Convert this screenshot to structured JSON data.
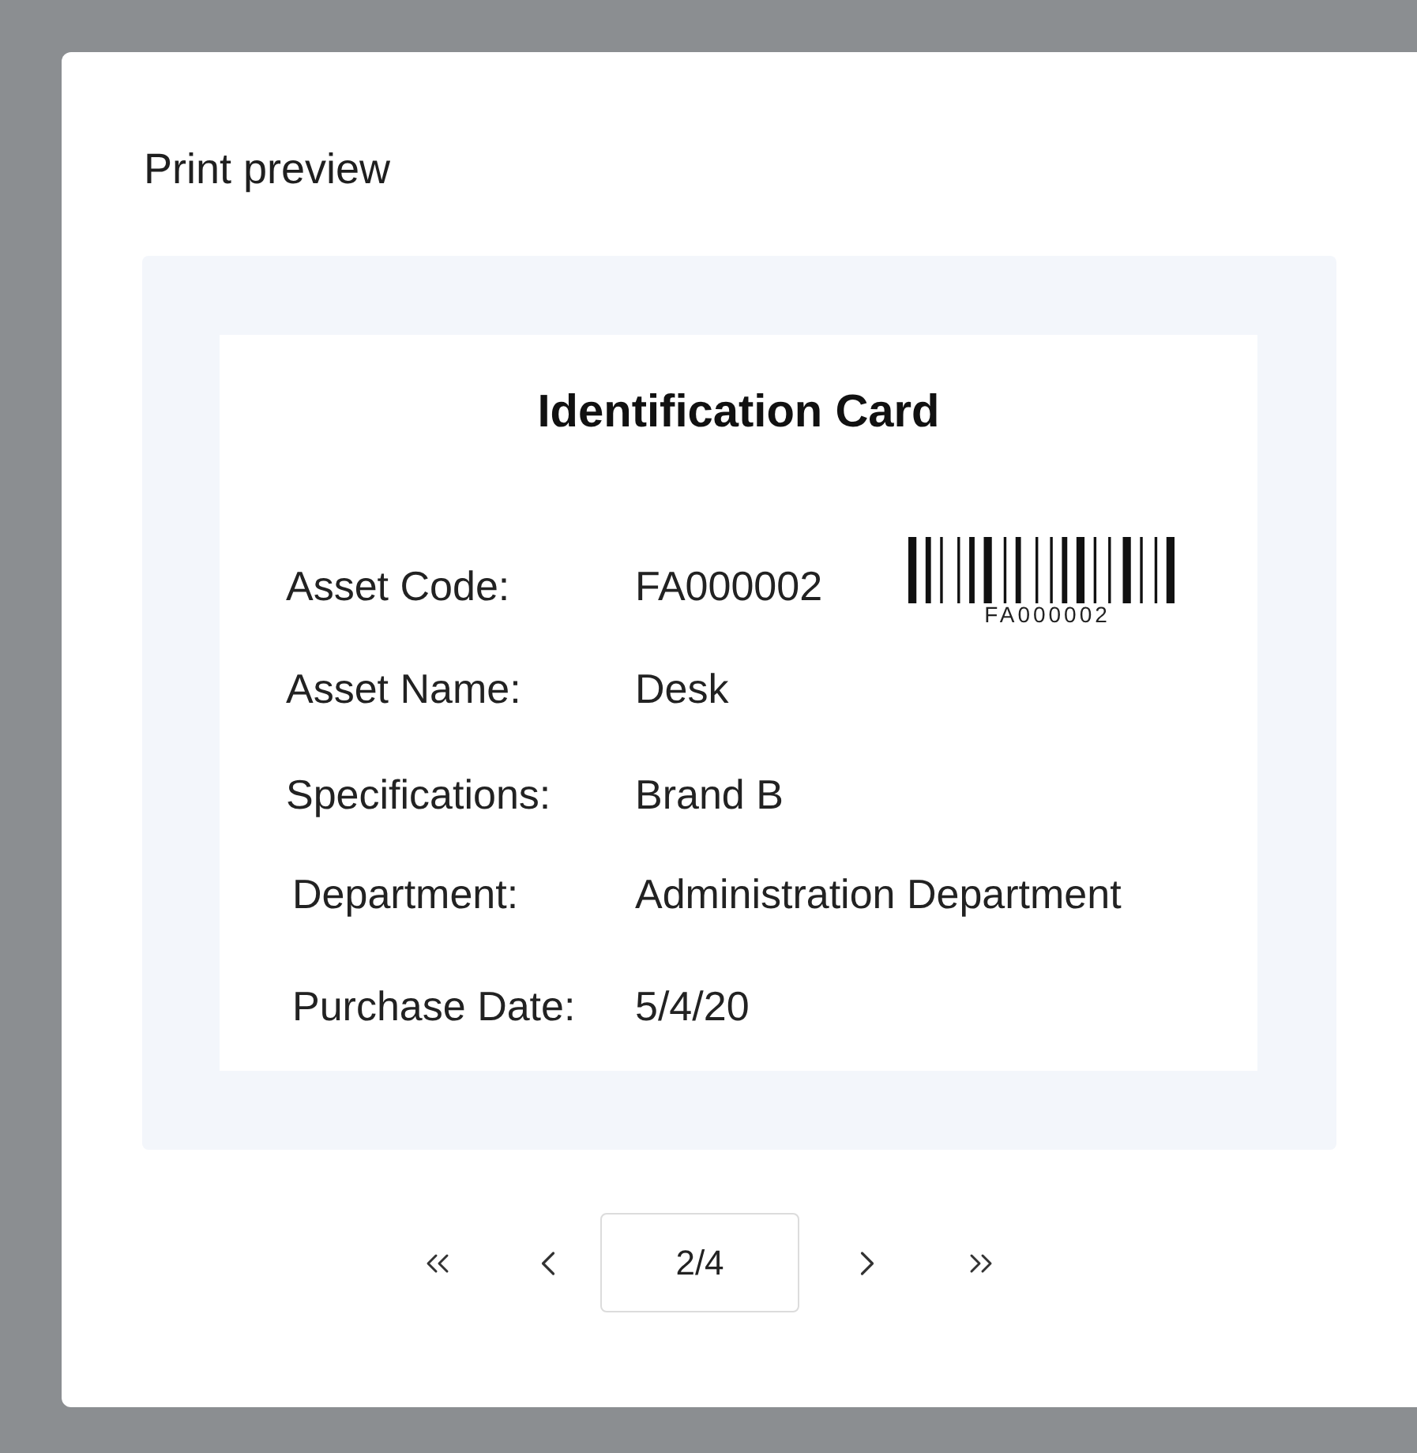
{
  "dialog": {
    "title": "Print preview"
  },
  "card": {
    "title": "Identification Card",
    "fields": [
      {
        "label": "Asset Code:",
        "value": "FA000002"
      },
      {
        "label": "Asset Name:",
        "value": "Desk"
      },
      {
        "label": "Specifications:",
        "value": "Brand B"
      },
      {
        "label": "Department:",
        "value": "Administration Department"
      },
      {
        "label": "Purchase Date:",
        "value": "5/4/20"
      }
    ],
    "barcode": {
      "text": "FA000002"
    }
  },
  "pagination": {
    "page": "2/4"
  }
}
